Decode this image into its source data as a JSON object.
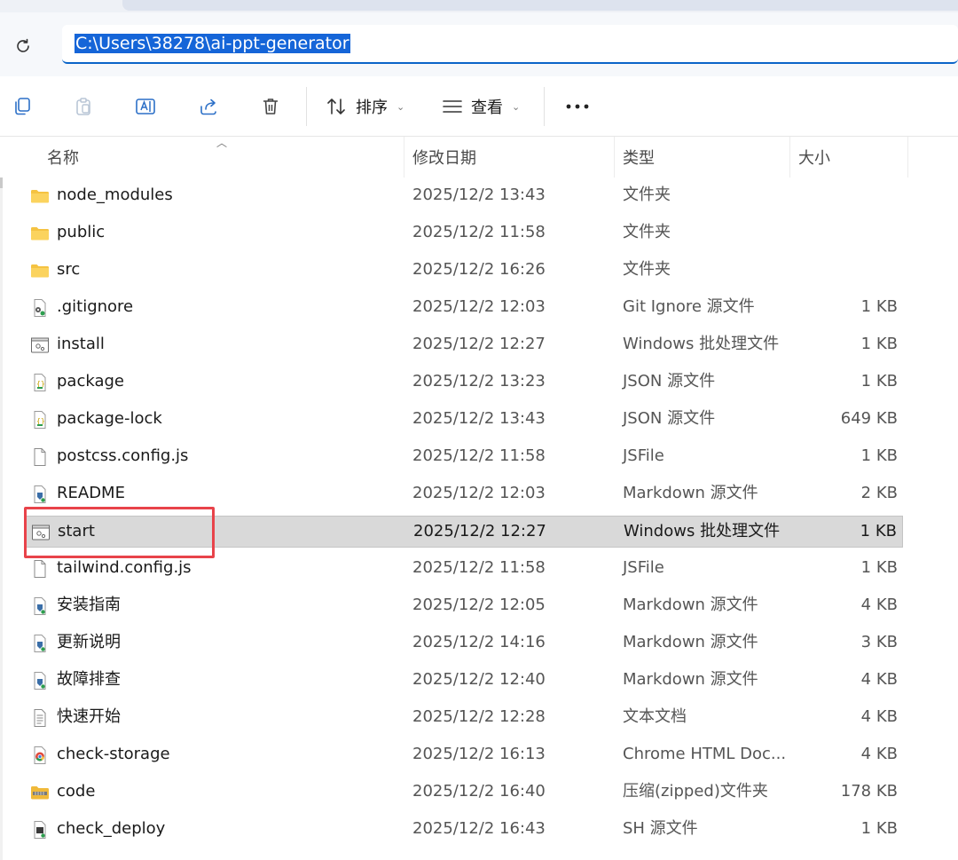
{
  "address_bar": {
    "path": "C:\\Users\\38278\\ai-ppt-generator"
  },
  "toolbar": {
    "sort_label": "排序",
    "view_label": "查看"
  },
  "columns": {
    "name": "名称",
    "date": "修改日期",
    "type": "类型",
    "size": "大小"
  },
  "files": [
    {
      "icon": "folder-icon",
      "name": "node_modules",
      "date": "2025/12/2 13:43",
      "type": "文件夹",
      "size": ""
    },
    {
      "icon": "folder-icon",
      "name": "public",
      "date": "2025/12/2 11:58",
      "type": "文件夹",
      "size": ""
    },
    {
      "icon": "folder-icon",
      "name": "src",
      "date": "2025/12/2 16:26",
      "type": "文件夹",
      "size": ""
    },
    {
      "icon": "gear-file-icon",
      "name": ".gitignore",
      "date": "2025/12/2 12:03",
      "type": "Git Ignore 源文件",
      "size": "1 KB"
    },
    {
      "icon": "batch-file-icon",
      "name": "install",
      "date": "2025/12/2 12:27",
      "type": "Windows 批处理文件",
      "size": "1 KB"
    },
    {
      "icon": "json-file-icon",
      "name": "package",
      "date": "2025/12/2 13:23",
      "type": "JSON 源文件",
      "size": "1 KB"
    },
    {
      "icon": "json-file-icon",
      "name": "package-lock",
      "date": "2025/12/2 13:43",
      "type": "JSON 源文件",
      "size": "649 KB"
    },
    {
      "icon": "blank-file-icon",
      "name": "postcss.config.js",
      "date": "2025/12/2 11:58",
      "type": "JSFile",
      "size": "1 KB"
    },
    {
      "icon": "markdown-file-icon",
      "name": "README",
      "date": "2025/12/2 12:03",
      "type": "Markdown 源文件",
      "size": "2 KB"
    },
    {
      "icon": "batch-file-icon",
      "name": "start",
      "date": "2025/12/2 12:27",
      "type": "Windows 批处理文件",
      "size": "1 KB",
      "selected": true
    },
    {
      "icon": "blank-file-icon",
      "name": "tailwind.config.js",
      "date": "2025/12/2 11:58",
      "type": "JSFile",
      "size": "1 KB"
    },
    {
      "icon": "markdown-file-icon",
      "name": "安装指南",
      "date": "2025/12/2 12:05",
      "type": "Markdown 源文件",
      "size": "4 KB"
    },
    {
      "icon": "markdown-file-icon",
      "name": "更新说明",
      "date": "2025/12/2 14:16",
      "type": "Markdown 源文件",
      "size": "3 KB"
    },
    {
      "icon": "markdown-file-icon",
      "name": "故障排查",
      "date": "2025/12/2 12:40",
      "type": "Markdown 源文件",
      "size": "4 KB"
    },
    {
      "icon": "text-file-icon",
      "name": "快速开始",
      "date": "2025/12/2 12:28",
      "type": "文本文档",
      "size": "4 KB"
    },
    {
      "icon": "chrome-html-icon",
      "name": "check-storage",
      "date": "2025/12/2 16:13",
      "type": "Chrome HTML Doc...",
      "size": "4 KB"
    },
    {
      "icon": "zip-folder-icon",
      "name": "code",
      "date": "2025/12/2 16:40",
      "type": "压缩(zipped)文件夹",
      "size": "178 KB"
    },
    {
      "icon": "shell-file-icon",
      "name": "check_deploy",
      "date": "2025/12/2 16:43",
      "type": "SH 源文件",
      "size": "1 KB"
    }
  ],
  "colors": {
    "selection": "#d9d9d9",
    "annotation": "#e8434a",
    "address_highlight": "#1565d8",
    "folder": "#f5c342"
  }
}
